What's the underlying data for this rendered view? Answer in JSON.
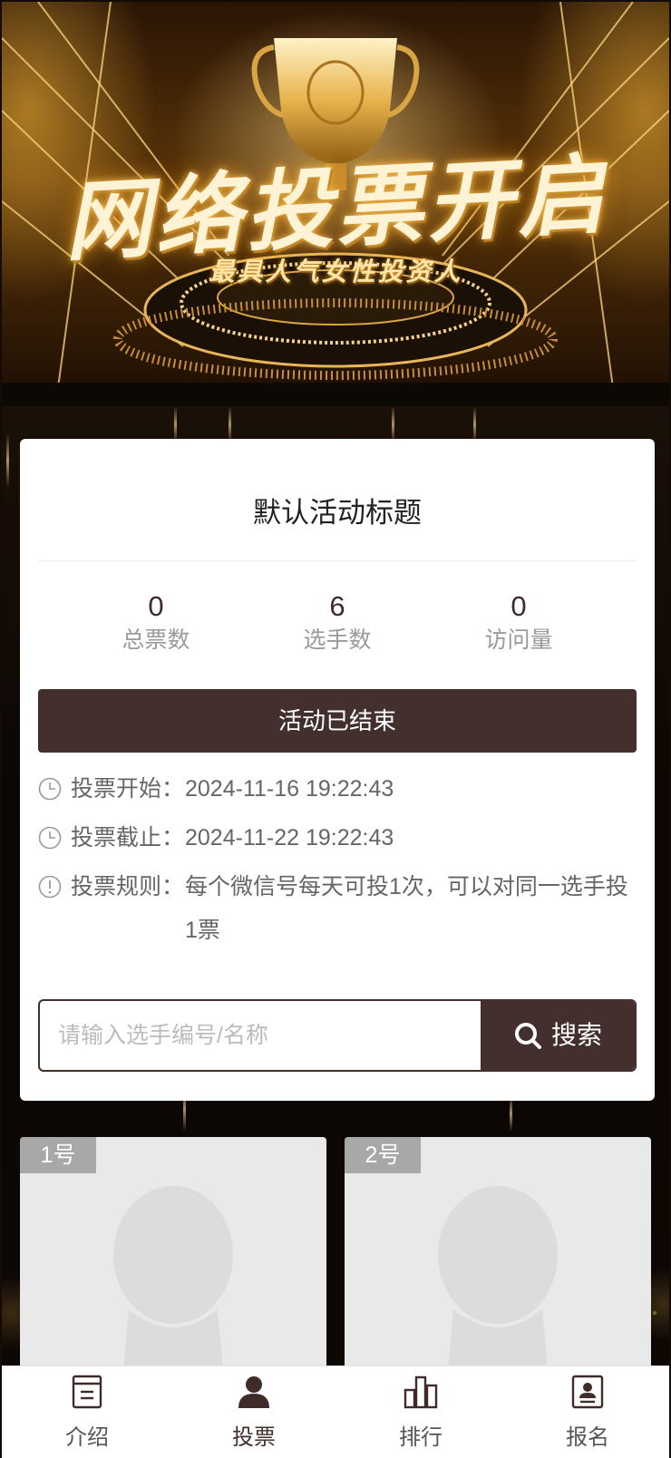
{
  "banner": {
    "title": "网络投票开启",
    "subtitle": "最具人气女性投资人"
  },
  "activity": {
    "title": "默认活动标题",
    "stats": [
      {
        "value": "0",
        "label": "总票数"
      },
      {
        "value": "6",
        "label": "选手数"
      },
      {
        "value": "0",
        "label": "访问量"
      }
    ],
    "status_button": "活动已结束",
    "info": [
      {
        "icon": "clock-icon",
        "label": "投票开始：",
        "value": "2024-11-16 19:22:43"
      },
      {
        "icon": "clock-icon",
        "label": "投票截止：",
        "value": "2024-11-22 19:22:43"
      },
      {
        "icon": "exclamation-circle-icon",
        "label": "投票规则：",
        "value": "每个微信号每天可投1次，可以对同一选手投1票"
      }
    ]
  },
  "search": {
    "placeholder": "请输入选手编号/名称",
    "button_label": "搜索"
  },
  "players": [
    {
      "number": "1号"
    },
    {
      "number": "2号"
    }
  ],
  "tabbar": {
    "items": [
      {
        "icon": "document-icon",
        "label": "介绍",
        "active": false
      },
      {
        "icon": "user-icon",
        "label": "投票",
        "active": true
      },
      {
        "icon": "bar-chart-icon",
        "label": "排行",
        "active": false
      },
      {
        "icon": "id-card-icon",
        "label": "报名",
        "active": false
      }
    ]
  },
  "colors": {
    "primary": "#43302e",
    "muted_text": "#9a9a9a",
    "card_bg": "#ffffff"
  }
}
